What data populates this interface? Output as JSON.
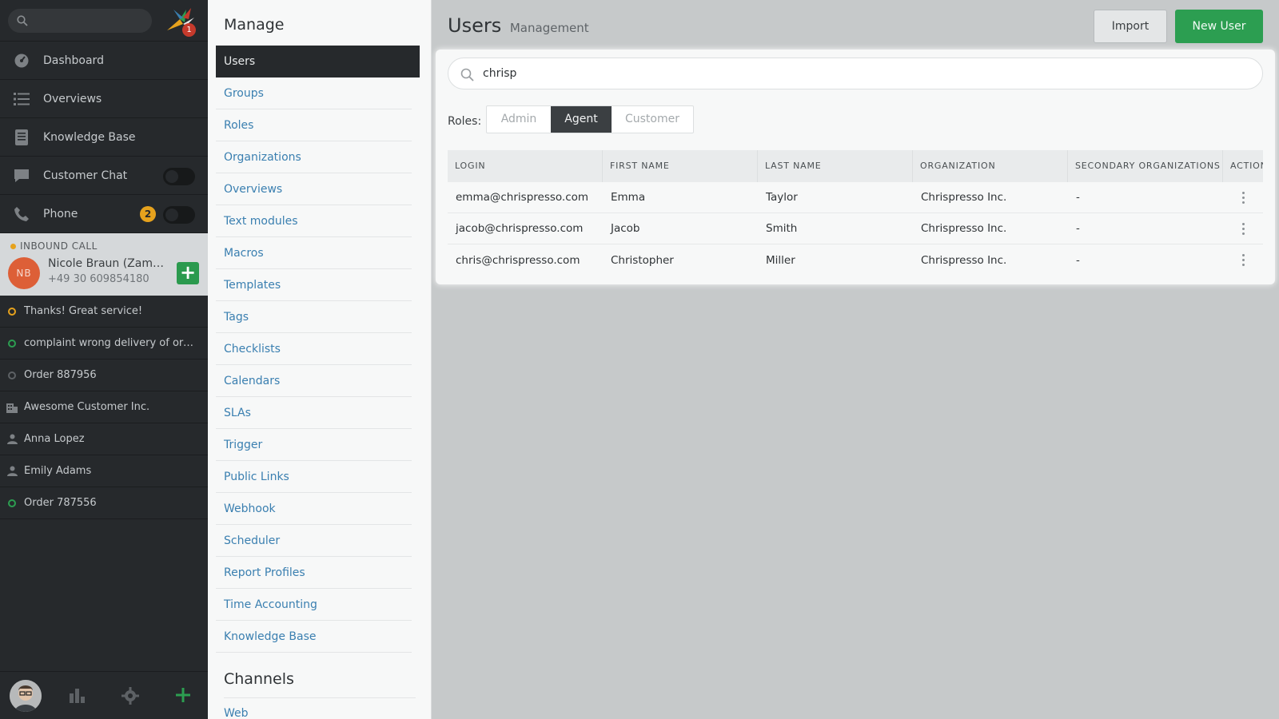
{
  "nav": {
    "search_placeholder": "",
    "logo_badge": "1",
    "items": [
      {
        "label": "Dashboard",
        "icon": "dashboard-icon"
      },
      {
        "label": "Overviews",
        "icon": "list-icon"
      },
      {
        "label": "Knowledge Base",
        "icon": "book-icon"
      },
      {
        "label": "Customer Chat",
        "icon": "chat-icon"
      },
      {
        "label": "Phone",
        "icon": "phone-icon",
        "badge": "2"
      }
    ],
    "call": {
      "title": "INBOUND CALL",
      "initials": "NB",
      "name": "Nicole Braun (Zammad)",
      "number": "+49 30 609854180"
    },
    "tasks": [
      {
        "label": "Thanks! Great service!",
        "icon": "ticket-open-icon",
        "color": "#e6a21d"
      },
      {
        "label": "complaint wrong delivery of ord...",
        "icon": "ticket-open-icon",
        "color": "#2c9e51"
      },
      {
        "label": "Order 887956",
        "icon": "ticket-closed-icon",
        "color": "#5d6165"
      },
      {
        "label": "Awesome Customer Inc.",
        "icon": "organization-icon",
        "color": "#8b9094"
      },
      {
        "label": "Anna Lopez",
        "icon": "user-icon",
        "color": "#8b9094"
      },
      {
        "label": "Emily Adams",
        "icon": "user-icon",
        "color": "#8b9094"
      },
      {
        "label": "Order 787556",
        "icon": "ticket-open-icon",
        "color": "#2c9e51"
      }
    ]
  },
  "manage": {
    "title": "Manage",
    "items": [
      "Users",
      "Groups",
      "Roles",
      "Organizations",
      "Overviews",
      "Text modules",
      "Macros",
      "Templates",
      "Tags",
      "Checklists",
      "Calendars",
      "SLAs",
      "Trigger",
      "Public Links",
      "Webhook",
      "Scheduler",
      "Report Profiles",
      "Time Accounting",
      "Knowledge Base"
    ],
    "channels_title": "Channels",
    "channels_first": "Web"
  },
  "main": {
    "title": "Users",
    "subtitle": "Management",
    "import_label": "Import",
    "new_user_label": "New User",
    "search_value": "chrisp",
    "roles_label": "Roles:",
    "roles": [
      {
        "label": "Admin",
        "active": false
      },
      {
        "label": "Agent",
        "active": true
      },
      {
        "label": "Customer",
        "active": false
      }
    ],
    "columns": [
      "LOGIN",
      "FIRST NAME",
      "LAST NAME",
      "ORGANIZATION",
      "SECONDARY ORGANIZATIONS",
      "ACTIONS"
    ],
    "rows": [
      [
        "emma@chrispresso.com",
        "Emma",
        "Taylor",
        "Chrispresso Inc.",
        "-"
      ],
      [
        "jacob@chrispresso.com",
        "Jacob",
        "Smith",
        "Chrispresso Inc.",
        "-"
      ],
      [
        "chris@chrispresso.com",
        "Christopher",
        "Miller",
        "Chrispresso Inc.",
        "-"
      ]
    ]
  },
  "colors": {
    "accent_green": "#2c9e51",
    "link_blue": "#3a7fb0",
    "nav_bg": "#26292c",
    "badge_orange": "#e6a21d"
  }
}
